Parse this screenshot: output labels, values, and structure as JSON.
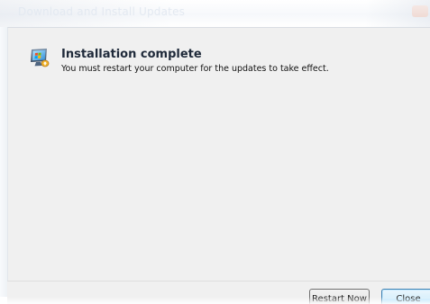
{
  "window": {
    "title": "Download and Install Updates"
  },
  "main": {
    "icon": "windows-update-icon",
    "heading": "Installation complete",
    "message": "You must restart your computer for the updates to take effect."
  },
  "footer": {
    "restart_label": "Restart Now",
    "close_label": "Close"
  },
  "colors": {
    "content_background": "#f0f0f0",
    "heading_text": "#1f2a3a",
    "default_button_border": "#3c7fb1"
  }
}
